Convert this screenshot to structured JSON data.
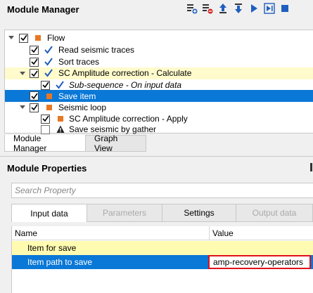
{
  "module_manager": {
    "title": "Module Manager",
    "toolbar": [
      {
        "name": "add-module-icon"
      },
      {
        "name": "remove-module-icon"
      },
      {
        "name": "move-up-icon"
      },
      {
        "name": "move-down-icon"
      },
      {
        "name": "run-icon"
      },
      {
        "name": "run-to-selected-icon"
      },
      {
        "name": "stop-icon"
      }
    ],
    "tree": [
      {
        "label": "Flow",
        "level": 0,
        "expanded": true,
        "checked": true,
        "icon": "square",
        "state": ""
      },
      {
        "label": "Read seismic traces",
        "level": 1,
        "checked": true,
        "icon": "check",
        "state": ""
      },
      {
        "label": "Sort traces",
        "level": 1,
        "checked": true,
        "icon": "check",
        "state": ""
      },
      {
        "label": "SC Amplitude correction - Calculate",
        "level": 1,
        "expanded": true,
        "checked": true,
        "icon": "check",
        "state": "highlight"
      },
      {
        "label": "Sub-sequence - On input data",
        "level": 2,
        "checked": true,
        "icon": "check",
        "state": "",
        "italic": true
      },
      {
        "label": "Save item",
        "level": 1,
        "checked": true,
        "icon": "square",
        "state": "selected"
      },
      {
        "label": "Seismic loop",
        "level": 1,
        "expanded": true,
        "checked": true,
        "icon": "square",
        "state": ""
      },
      {
        "label": "SC Amplitude correction - Apply",
        "level": 2,
        "checked": true,
        "icon": "square",
        "state": ""
      },
      {
        "label": "Save seismic by gather",
        "level": 2,
        "checked": false,
        "icon": "warning",
        "state": ""
      }
    ],
    "tabs": [
      {
        "label": "Module Manager",
        "active": true
      },
      {
        "label": "Graph View",
        "active": false
      }
    ]
  },
  "module_properties": {
    "title": "Module Properties",
    "search_placeholder": "Search Property",
    "tabs": [
      {
        "label": "Input data",
        "active": true,
        "disabled": false
      },
      {
        "label": "Parameters",
        "active": false,
        "disabled": true
      },
      {
        "label": "Settings",
        "active": false,
        "disabled": false
      },
      {
        "label": "Output data",
        "active": false,
        "disabled": true
      }
    ],
    "columns": {
      "name": "Name",
      "value": "Value"
    },
    "rows": [
      {
        "name": "Item for save",
        "value": ""
      },
      {
        "name": "Item path to save",
        "value": "amp-recovery-operators"
      }
    ]
  },
  "colors": {
    "selection": "#0a78d7",
    "highlight": "#fffbcc",
    "accent_square": "#e87722",
    "check_blue": "#1f5fbf",
    "value_outline": "#e0101a"
  }
}
